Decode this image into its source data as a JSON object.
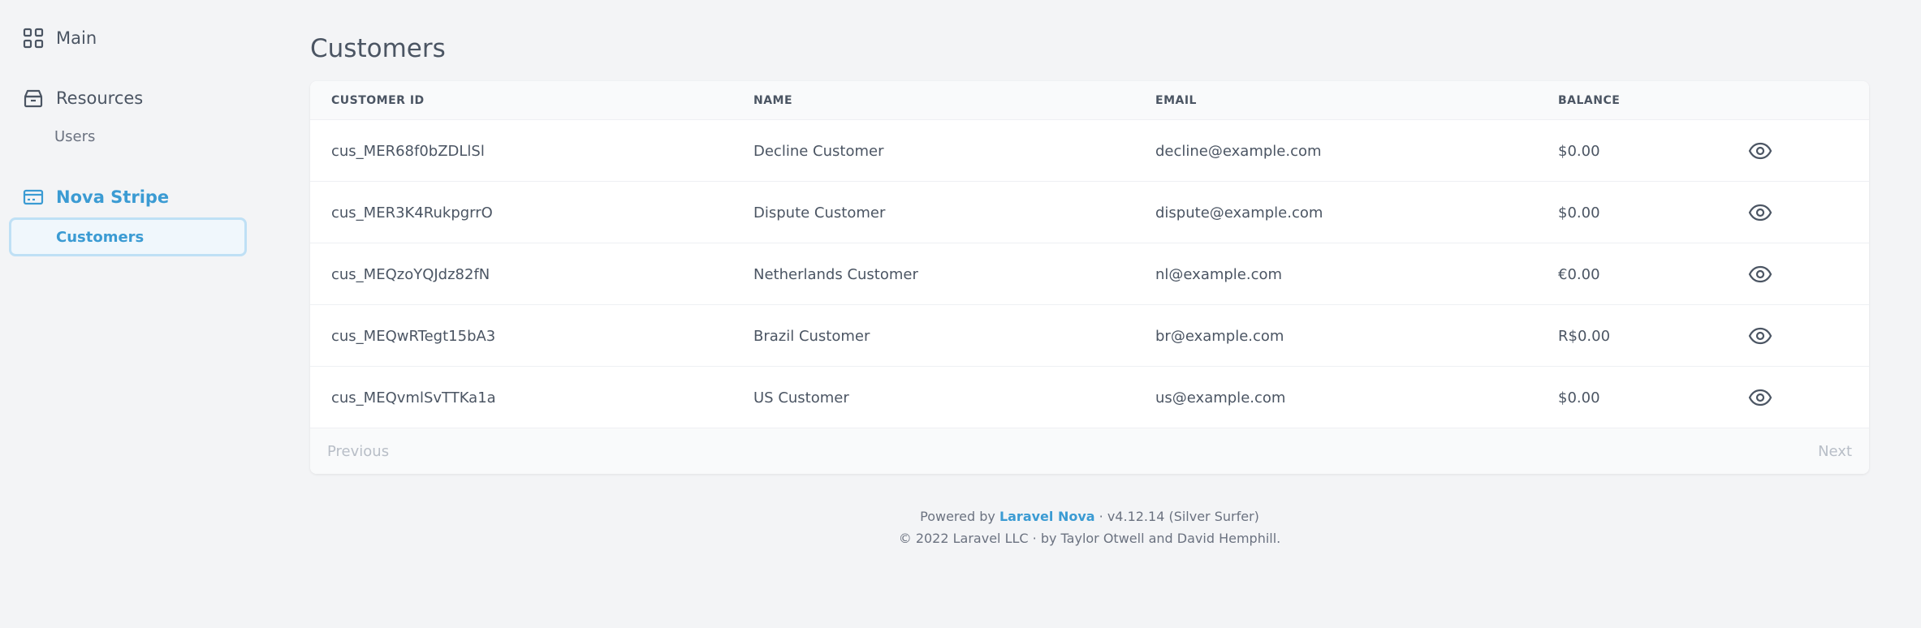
{
  "sidebar": {
    "main": {
      "label": "Main",
      "icon": "grid-icon"
    },
    "resources": {
      "label": "Resources",
      "icon": "archive-icon",
      "items": [
        {
          "label": "Users"
        }
      ]
    },
    "nova_stripe": {
      "label": "Nova Stripe",
      "icon": "credit-card-icon",
      "items": [
        {
          "label": "Customers",
          "active": true
        }
      ]
    }
  },
  "page": {
    "title": "Customers"
  },
  "table": {
    "columns": [
      "CUSTOMER ID",
      "NAME",
      "EMAIL",
      "BALANCE"
    ],
    "rows": [
      {
        "id": "cus_MER68f0bZDLlSl",
        "name": "Decline Customer",
        "email": "decline@example.com",
        "balance": "$0.00"
      },
      {
        "id": "cus_MER3K4RukpgrrO",
        "name": "Dispute Customer",
        "email": "dispute@example.com",
        "balance": "$0.00"
      },
      {
        "id": "cus_MEQzoYQJdz82fN",
        "name": "Netherlands Customer",
        "email": "nl@example.com",
        "balance": "€0.00"
      },
      {
        "id": "cus_MEQwRTegt15bA3",
        "name": "Brazil Customer",
        "email": "br@example.com",
        "balance": "R$0.00"
      },
      {
        "id": "cus_MEQvmlSvTTKa1a",
        "name": "US Customer",
        "email": "us@example.com",
        "balance": "$0.00"
      }
    ],
    "row_action_icon": "eye-icon"
  },
  "pagination": {
    "previous": "Previous",
    "next": "Next"
  },
  "footer": {
    "powered_prefix": "Powered by",
    "link": "Laravel Nova",
    "version": "· v4.12.14 (Silver Surfer)",
    "copyright": "© 2022 Laravel LLC · by Taylor Otwell and David Hemphill."
  },
  "colors": {
    "accent": "#3b9bd3",
    "background": "#f3f4f6",
    "text": "#4b5563",
    "muted": "#b8bec7"
  }
}
